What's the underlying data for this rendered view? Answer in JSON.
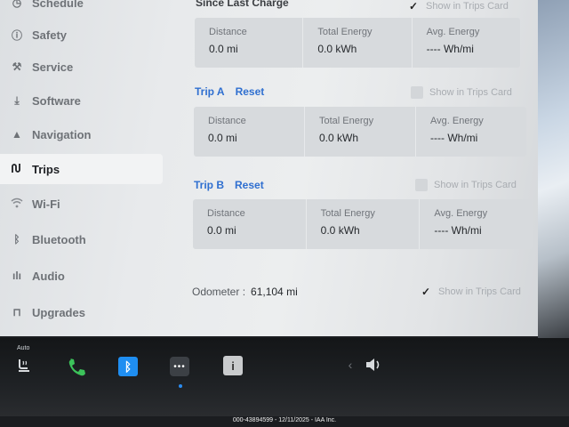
{
  "sidebar": {
    "items": [
      {
        "label": "Schedule",
        "icon": "clock-icon"
      },
      {
        "label": "Safety",
        "icon": "safety-icon"
      },
      {
        "label": "Service",
        "icon": "wrench-icon"
      },
      {
        "label": "Software",
        "icon": "download-icon"
      },
      {
        "label": "Navigation",
        "icon": "navigation-arrow-icon"
      },
      {
        "label": "Trips",
        "icon": "trips-icon",
        "active": true
      },
      {
        "label": "Wi-Fi",
        "icon": "wifi-icon"
      },
      {
        "label": "Bluetooth",
        "icon": "bluetooth-icon"
      },
      {
        "label": "Audio",
        "icon": "audio-icon"
      },
      {
        "label": "Upgrades",
        "icon": "lock-icon"
      }
    ]
  },
  "since_last_charge": {
    "title": "Since Last Charge",
    "show_label": "Show in Trips Card",
    "checked": true,
    "distance_label": "Distance",
    "distance": "0.0 mi",
    "energy_label": "Total Energy",
    "energy": "0.0 kWh",
    "avg_label": "Avg. Energy",
    "avg": "---- Wh/mi"
  },
  "trip_a": {
    "title": "Trip A",
    "reset": "Reset",
    "show_label": "Show in Trips Card",
    "checked": false,
    "distance_label": "Distance",
    "distance": "0.0 mi",
    "energy_label": "Total Energy",
    "energy": "0.0 kWh",
    "avg_label": "Avg. Energy",
    "avg": "---- Wh/mi"
  },
  "trip_b": {
    "title": "Trip B",
    "reset": "Reset",
    "show_label": "Show in Trips Card",
    "checked": false,
    "distance_label": "Distance",
    "distance": "0.0 mi",
    "energy_label": "Total Energy",
    "energy": "0.0 kWh",
    "avg_label": "Avg. Energy",
    "avg": "---- Wh/mi"
  },
  "odometer": {
    "label": "Odometer :",
    "value": "61,104 mi",
    "show_label": "Show in Trips Card",
    "checked": true
  },
  "dock": {
    "auto_label": "Auto",
    "seat_heater_icon": "seat-heater-icon",
    "phone_icon": "phone-icon",
    "bluetooth_icon": "bluetooth-icon",
    "more_icon": "more-dots-icon",
    "info_icon": "info-icon",
    "volume_icon": "volume-icon"
  },
  "footer": {
    "caption": "000-43894599 - 12/11/2025 - IAA Inc."
  },
  "colors": {
    "accent_blue": "#2f6fd0",
    "phone_green": "#3cc25a",
    "bluetooth_blue": "#1f8ef1"
  }
}
